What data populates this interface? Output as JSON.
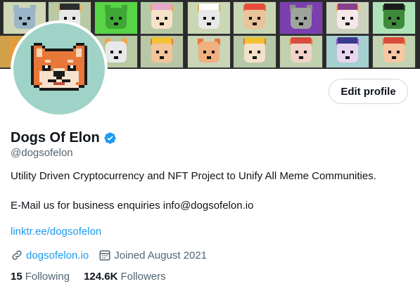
{
  "banner": {
    "tiles": [
      {
        "bg": "#cfd7b6",
        "face": "#9bb6c8",
        "ear": "#9bb6c8",
        "hat": ""
      },
      {
        "bg": "#b8c9a4",
        "face": "#e7e7e7",
        "ear": "#f2a64a",
        "hat": "#2c2c2c"
      },
      {
        "bg": "#58d447",
        "face": "#3ea834",
        "ear": "#3ea834",
        "hat": ""
      },
      {
        "bg": "#b6c9a7",
        "face": "#f7e2c8",
        "ear": "#f2a64a",
        "hat": "#e8a6c8"
      },
      {
        "bg": "#cad7b4",
        "face": "#e8e8e8",
        "ear": "#f2a64a",
        "hat": "#ffffff"
      },
      {
        "bg": "#c9d6b4",
        "face": "#e9c39a",
        "ear": "#e56d33",
        "hat": "#e84b3a"
      },
      {
        "bg": "#7b3fb0",
        "face": "#9ea39b",
        "ear": "#8d9189",
        "hat": ""
      },
      {
        "bg": "#cbd3bf",
        "face": "#f6e8e8",
        "ear": "#f2a64a",
        "hat": "#8a3f8a"
      },
      {
        "bg": "#aee3b9",
        "face": "#3e8a3c",
        "ear": "#2b6b2a",
        "hat": "#1a1a1a"
      },
      {
        "bg": "#cfa24a",
        "face": "#e89a3d",
        "ear": "#e89a3d",
        "hat": ""
      },
      {
        "bg": "#b8c9a4",
        "face": "#e8e8e8",
        "ear": "#f2a64a",
        "hat": ""
      },
      {
        "bg": "#bac7a6",
        "face": "#f3c39a",
        "ear": "#e87b3b",
        "hat": "#f1c232"
      },
      {
        "bg": "#cbd5b7",
        "face": "#f0b080",
        "ear": "#e8773a",
        "hat": ""
      },
      {
        "bg": "#b6c9a6",
        "face": "#f4e1c9",
        "ear": "#e8773a",
        "hat": "#f1c232"
      },
      {
        "bg": "#c0d1ae",
        "face": "#f1d3c8",
        "ear": "#e8773a",
        "hat": "#d84c3b"
      },
      {
        "bg": "#a6cfd0",
        "face": "#e8d6f0",
        "ear": "#9f5ac7",
        "hat": "#3a3a8a"
      },
      {
        "bg": "#c3d2b1",
        "face": "#f7c7a2",
        "ear": "#e8773a",
        "hat": "#d84c3b"
      },
      {
        "bg": "#cbd3bf",
        "face": "#f3eaf0",
        "ear": "#d06aa0",
        "hat": "#d84c8b"
      },
      {
        "bg": "#b8dcc7",
        "face": "#e8eef2",
        "ear": "#6f8fb0",
        "hat": ""
      }
    ]
  },
  "profile": {
    "display_name": "Dogs Of Elon",
    "handle": "@dogsofelon",
    "bio_line1": "Utility Driven Cryptocurrency and NFT Project to Unify All Meme Communities.",
    "bio_line2": "E-Mail us for business enquiries info@dogsofelon.io",
    "bio_link": "linktr.ee/dogsofelon",
    "website": "dogsofelon.io",
    "joined": "Joined August 2021",
    "following_count": "15",
    "following_label": "Following",
    "followers_count": "124.6K",
    "followers_label": "Followers"
  },
  "buttons": {
    "edit_profile": "Edit profile"
  },
  "icons": {
    "verified": "verified-badge-icon",
    "link": "link-icon",
    "calendar": "calendar-icon"
  },
  "colors": {
    "accent": "#1d9bf0",
    "secondary_text": "#536471",
    "avatar_bg": "#9fd3c7"
  }
}
